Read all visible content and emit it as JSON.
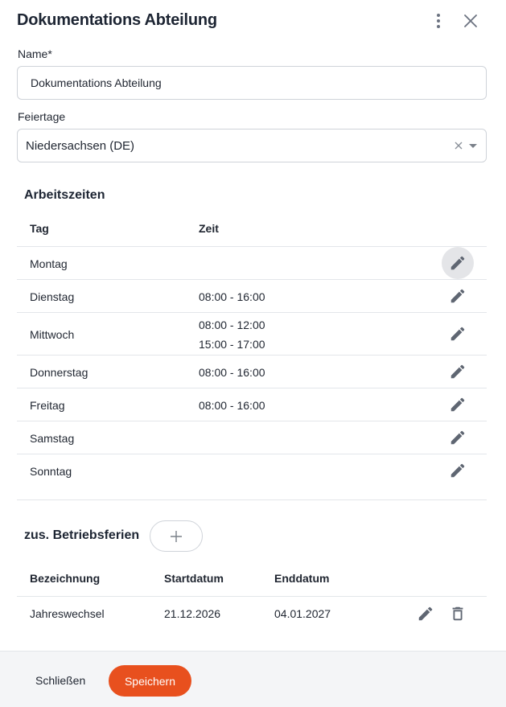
{
  "dialog": {
    "title": "Dokumentations Abteilung"
  },
  "icons": {
    "menu": "more-vertical-icon",
    "close": "close-icon",
    "edit": "pencil-icon",
    "delete": "trash-icon",
    "add": "plus-icon",
    "clear": "clear-x-icon",
    "dropdown": "caret-down-icon"
  },
  "name_field": {
    "label": "Name*",
    "value": "Dokumentations Abteilung"
  },
  "holidays": {
    "label": "Feiertage",
    "value": "Niedersachsen (DE)"
  },
  "working_hours": {
    "title": "Arbeitszeiten",
    "headers": {
      "day": "Tag",
      "time": "Zeit"
    },
    "rows": [
      {
        "day": "Montag",
        "time1": "",
        "time2": ""
      },
      {
        "day": "Dienstag",
        "time1": "08:00 - 16:00",
        "time2": ""
      },
      {
        "day": "Mittwoch",
        "time1": "08:00 - 12:00",
        "time2": "15:00 - 17:00"
      },
      {
        "day": "Donnerstag",
        "time1": "08:00 - 16:00",
        "time2": ""
      },
      {
        "day": "Freitag",
        "time1": "08:00 - 16:00",
        "time2": ""
      },
      {
        "day": "Samstag",
        "time1": "",
        "time2": ""
      },
      {
        "day": "Sonntag",
        "time1": "",
        "time2": ""
      }
    ]
  },
  "company_holidays": {
    "title": "zus. Betriebsferien",
    "headers": {
      "name": "Bezeichnung",
      "start": "Startdatum",
      "end": "Enddatum"
    },
    "rows": [
      {
        "name": "Jahreswechsel",
        "start": "21.12.2026",
        "end": "04.01.2027"
      }
    ]
  },
  "footer": {
    "close_label": "Schließen",
    "save_label": "Speichern"
  },
  "colors": {
    "accent": "#e8501e",
    "text": "#1f2530",
    "icon": "#6b7280"
  }
}
